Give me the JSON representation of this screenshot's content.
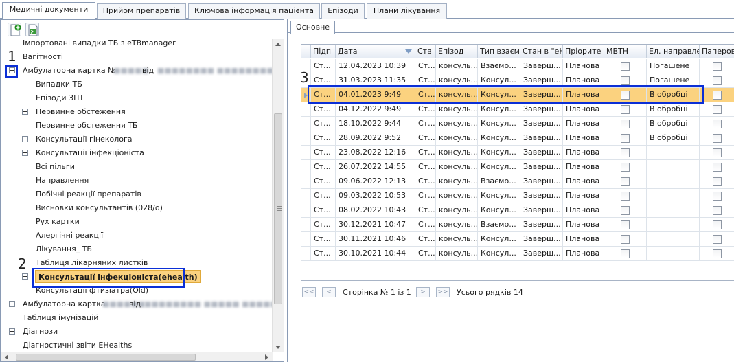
{
  "top_tabs": [
    {
      "label": "Медичні документи",
      "active": true
    },
    {
      "label": "Прийом препаратів",
      "active": false
    },
    {
      "label": "Ключова інформація пацієнта",
      "active": false
    },
    {
      "label": "Епізоди",
      "active": false
    },
    {
      "label": "Плани лікування",
      "active": false
    }
  ],
  "tree": {
    "items": [
      {
        "label": "Імпортовані випадки ТБ з eTBmanager",
        "expander": "none"
      },
      {
        "label": "Вагітності",
        "expander": "none"
      },
      {
        "label": "Амбулаторна картка №",
        "label_mid": "від",
        "expander": "minus"
      },
      {
        "label": "Випадки ТБ",
        "expander": "none"
      },
      {
        "label": "Епізоди ЗПТ",
        "expander": "none"
      },
      {
        "label": "Первинне обстеження",
        "expander": "plus"
      },
      {
        "label": "Первинне обстеження ТБ",
        "expander": "none"
      },
      {
        "label": "Консультації гінеколога",
        "expander": "plus"
      },
      {
        "label": "Консультації інфекціоніста",
        "expander": "plus"
      },
      {
        "label": "Всі пільги",
        "expander": "none"
      },
      {
        "label": "Направлення",
        "expander": "none"
      },
      {
        "label": "Побічні реакції препаратів",
        "expander": "none"
      },
      {
        "label": "Висновки консультантів (028/о)",
        "expander": "none"
      },
      {
        "label": "Рух картки",
        "expander": "none"
      },
      {
        "label": "Алергічні реакції",
        "expander": "none"
      },
      {
        "label": "Лікування_ ТБ",
        "expander": "none"
      },
      {
        "label": "Таблиця лікарняних листків",
        "expander": "none"
      },
      {
        "label": "Консультації інфекціоніста(ehealth)",
        "expander": "plus",
        "selected": true
      },
      {
        "label": "Консультації фтизіатра(Old)",
        "expander": "none"
      },
      {
        "label": "Амбулаторна картка",
        "label_mid": "від",
        "expander": "plus"
      },
      {
        "label": "Таблиця імунізацій",
        "expander": "none"
      },
      {
        "label": "Діагнози",
        "expander": "plus"
      },
      {
        "label": "Діагностичні звіти EHealths",
        "expander": "none"
      }
    ]
  },
  "annotations": [
    "1",
    "2",
    "3"
  ],
  "sub_tabs": [
    {
      "label": "Основне",
      "active": true
    }
  ],
  "grid": {
    "columns": [
      "Підп",
      "Дата",
      "Ств",
      "Епізод",
      "Тип взаєм",
      "Стан в \"eH",
      "Пріорите",
      "МВТН",
      "Ел. направле",
      "Паперов"
    ],
    "rows": [
      {
        "c0": "Ст...",
        "date": "12.04.2023 10:39",
        "c2": "Ст...",
        "episode": "консуль...",
        "type": "Взаємо...",
        "state": "Заверш...",
        "priority": "Планова",
        "mvtn": false,
        "el": "Погашене",
        "paper": false
      },
      {
        "c0": "Ст...",
        "date": "31.03.2023 11:35",
        "c2": "Ст...",
        "episode": "консуль...",
        "type": "Консул...",
        "state": "Заверш...",
        "priority": "Планова",
        "mvtn": false,
        "el": "Погашене",
        "paper": false
      },
      {
        "c0": "Ст...",
        "date": "04.01.2023 9:49",
        "c2": "Ст...",
        "episode": "консуль...",
        "type": "Консул...",
        "state": "Заверш...",
        "priority": "Планова",
        "mvtn": false,
        "el": "В обробці",
        "paper": false,
        "selected": true
      },
      {
        "c0": "Ст...",
        "date": "04.12.2022 9:49",
        "c2": "Ст...",
        "episode": "консуль...",
        "type": "Консул...",
        "state": "Заверш...",
        "priority": "Планова",
        "mvtn": false,
        "el": "В обробці",
        "paper": false
      },
      {
        "c0": "Ст...",
        "date": "18.10.2022 9:44",
        "c2": "Ст...",
        "episode": "консуль...",
        "type": "Консул...",
        "state": "Заверш...",
        "priority": "Планова",
        "mvtn": false,
        "el": "В обробці",
        "paper": false
      },
      {
        "c0": "Ст...",
        "date": "28.09.2022 9:52",
        "c2": "Ст...",
        "episode": "консуль...",
        "type": "Консул...",
        "state": "Заверш...",
        "priority": "Планова",
        "mvtn": false,
        "el": "В обробці",
        "paper": false
      },
      {
        "c0": "Ст...",
        "date": "23.08.2022 12:16",
        "c2": "Ст...",
        "episode": "консуль...",
        "type": "Консул...",
        "state": "Заверш...",
        "priority": "Планова",
        "mvtn": false,
        "el": "",
        "paper": false
      },
      {
        "c0": "Ст...",
        "date": "26.07.2022 14:55",
        "c2": "Ст...",
        "episode": "консуль...",
        "type": "Консул...",
        "state": "Заверш...",
        "priority": "Планова",
        "mvtn": false,
        "el": "",
        "paper": false
      },
      {
        "c0": "Ст...",
        "date": "09.06.2022 12:13",
        "c2": "Ст...",
        "episode": "консуль...",
        "type": "Взаємо...",
        "state": "Заверш...",
        "priority": "Планова",
        "mvtn": false,
        "el": "",
        "paper": false
      },
      {
        "c0": "Ст...",
        "date": "09.03.2022 10:53",
        "c2": "Ст...",
        "episode": "консуль...",
        "type": "Консул...",
        "state": "Заверш...",
        "priority": "Планова",
        "mvtn": false,
        "el": "",
        "paper": false
      },
      {
        "c0": "Ст...",
        "date": "08.02.2022 10:43",
        "c2": "Ст...",
        "episode": "консуль...",
        "type": "Консул...",
        "state": "Заверш...",
        "priority": "Планова",
        "mvtn": false,
        "el": "",
        "paper": false
      },
      {
        "c0": "Ст...",
        "date": "30.12.2021 10:47",
        "c2": "Ст...",
        "episode": "консуль...",
        "type": "Взаємо...",
        "state": "Заверш...",
        "priority": "Планова",
        "mvtn": false,
        "el": "",
        "paper": false
      },
      {
        "c0": "Ст...",
        "date": "30.11.2021 10:46",
        "c2": "Ст...",
        "episode": "консуль...",
        "type": "Консул...",
        "state": "Заверш...",
        "priority": "Планова",
        "mvtn": false,
        "el": "",
        "paper": false
      },
      {
        "c0": "Ст...",
        "date": "30.10.2021 10:44",
        "c2": "Ст...",
        "episode": "консуль...",
        "type": "Консул...",
        "state": "Заверш...",
        "priority": "Планова",
        "mvtn": false,
        "el": "",
        "paper": false
      }
    ]
  },
  "pager": {
    "first": "<<",
    "prev": "<",
    "next": ">",
    "last": ">>",
    "page_text": "Сторінка № 1 із 1",
    "total_text": "Усього рядків 14"
  },
  "colors": {
    "selection": "#fbd27f",
    "annotation_box": "#0b2fd6",
    "border": "#8a9bb5"
  },
  "icons": {
    "toolbar": [
      "add-document-icon",
      "export-document-icon"
    ]
  }
}
